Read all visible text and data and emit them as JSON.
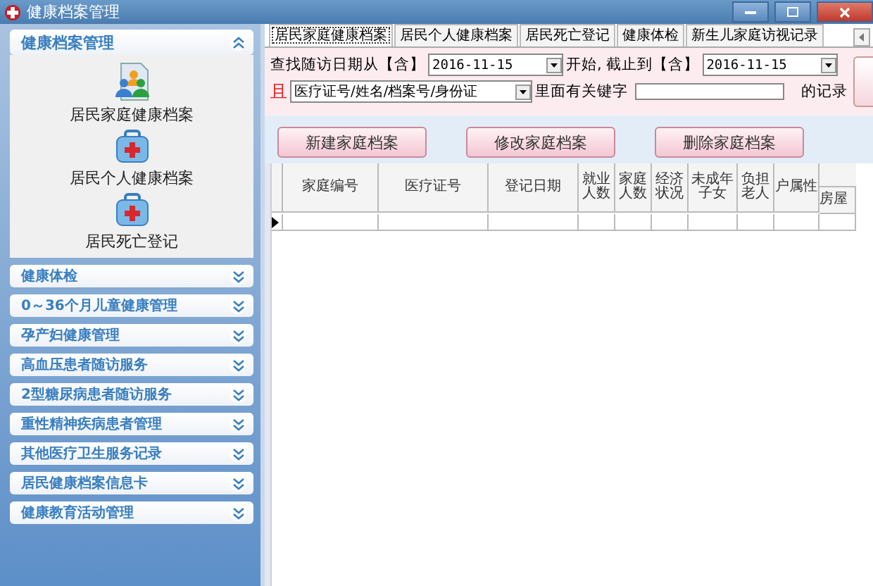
{
  "window": {
    "title": "健康档案管理"
  },
  "sidebar": {
    "sections": [
      {
        "title": "健康档案管理",
        "expanded": true,
        "items": [
          {
            "label": "居民家庭健康档案",
            "kind": "family"
          },
          {
            "label": "居民个人健康档案",
            "kind": "kit"
          },
          {
            "label": "居民死亡登记",
            "kind": "kit"
          }
        ]
      },
      {
        "title": "健康体检",
        "expanded": false
      },
      {
        "title": "0～36个月儿童健康管理",
        "expanded": false
      },
      {
        "title": "孕产妇健康管理",
        "expanded": false
      },
      {
        "title": "高血压患者随访服务",
        "expanded": false
      },
      {
        "title": "2型糖尿病患者随访服务",
        "expanded": false
      },
      {
        "title": "重性精神疾病患者管理",
        "expanded": false
      },
      {
        "title": "其他医疗卫生服务记录",
        "expanded": false
      },
      {
        "title": "居民健康档案信息卡",
        "expanded": false
      },
      {
        "title": "健康教育活动管理",
        "expanded": false
      }
    ]
  },
  "tabs": [
    {
      "label": "居民家庭健康档案",
      "selected": true
    },
    {
      "label": "居民个人健康档案",
      "selected": false
    },
    {
      "label": "居民死亡登记",
      "selected": false
    },
    {
      "label": "健康体检",
      "selected": false
    },
    {
      "label": "新生儿家庭访视记录",
      "selected": false
    }
  ],
  "filter": {
    "from_label": "查找随访日期从【含】",
    "from_value": "2016-11-15",
    "to_label": "开始, 截止到【含】",
    "to_value": "2016-11-15",
    "and_label": "且",
    "field_value": "医疗证号/姓名/档案号/身份证",
    "keyword_label": "里面有关键字",
    "suffix": "的记录"
  },
  "buttons": [
    "新建家庭档案",
    "修改家庭档案",
    "删除家庭档案"
  ],
  "grid": {
    "columns": [
      {
        "label": "家庭编号",
        "kind": "wide"
      },
      {
        "label": "医疗证号",
        "kind": "wide"
      },
      {
        "label": "登记日期",
        "kind": "wide"
      },
      {
        "label": "就业人数",
        "kind": "narrow"
      },
      {
        "label": "家庭人数",
        "kind": "narrow"
      },
      {
        "label": "经济状况",
        "kind": "narrow"
      },
      {
        "label": "未成年子女",
        "kind": "narrow"
      },
      {
        "label": "负担老人",
        "kind": "narrow"
      },
      {
        "label": "户属性",
        "kind": "narrow"
      },
      {
        "label": "房屋",
        "kind": "sub"
      }
    ],
    "rows": [
      {
        "current": true
      }
    ]
  }
}
